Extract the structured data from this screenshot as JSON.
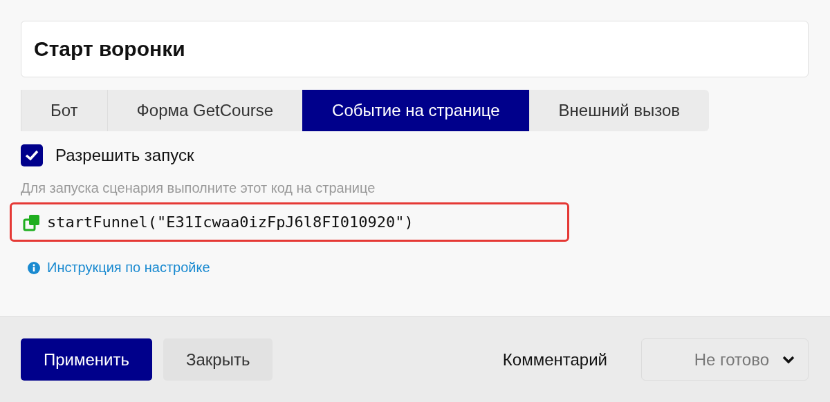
{
  "title_field": {
    "value": "Старт воронки"
  },
  "tabs": [
    {
      "label": "Бот",
      "selected": false
    },
    {
      "label": "Форма GetCourse",
      "selected": false
    },
    {
      "label": "Событие на странице",
      "selected": true
    },
    {
      "label": "Внешний вызов",
      "selected": false
    }
  ],
  "allow_start": {
    "label": "Разрешить запуск",
    "checked": true
  },
  "hint": "Для запуска сценария выполните этот код на странице",
  "code": {
    "text": "startFunnel(\"E31Icwaa0izFpJ6l8FI010920\")",
    "highlighted": true
  },
  "help_link": "Инструкция по настройке",
  "footer": {
    "apply_button": "Применить",
    "close_button": "Закрыть",
    "comment_label": "Комментарий",
    "status_select": {
      "value": "Не готово"
    }
  }
}
